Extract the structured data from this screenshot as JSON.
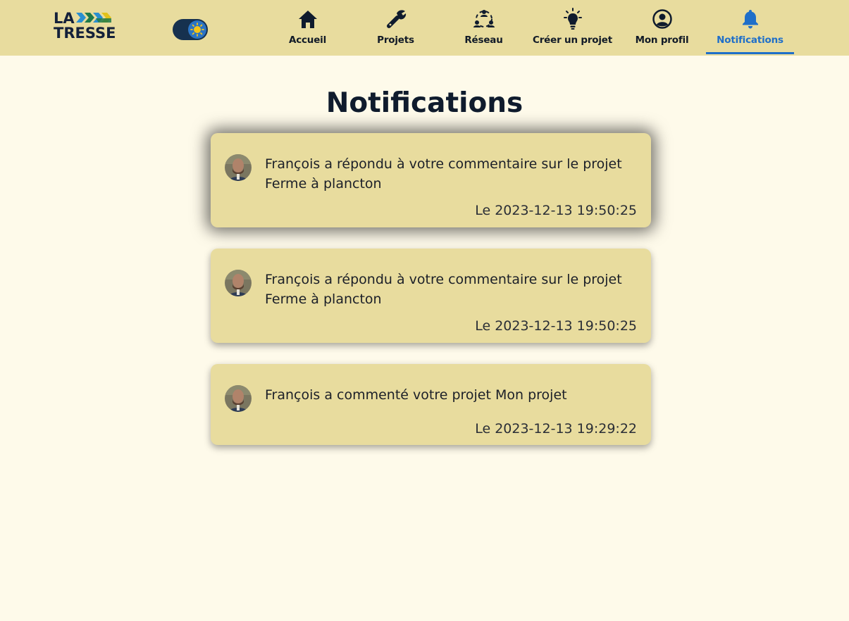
{
  "brand": {
    "line1": "LA",
    "line2": "TRESSE"
  },
  "theme_toggle": {
    "icon": "sun-icon",
    "accent": "#2b74c4"
  },
  "nav": [
    {
      "label": "Accueil",
      "icon": "home-icon"
    },
    {
      "label": "Projets",
      "icon": "tools-icon"
    },
    {
      "label": "Réseau",
      "icon": "network-icon"
    },
    {
      "label": "Créer un projet",
      "icon": "lightbulb-icon"
    },
    {
      "label": "Mon profil",
      "icon": "user-circle-icon"
    },
    {
      "label": "Notifications",
      "icon": "bell-icon",
      "active": true
    }
  ],
  "page": {
    "title": "Notifications"
  },
  "notifications": [
    {
      "text": "François a répondu à votre commentaire sur le projet Ferme à plancton",
      "date": "Le 2023-12-13 19:50:25",
      "avatar": "avatar"
    },
    {
      "text": "François a répondu à votre commentaire sur le projet Ferme à plancton",
      "date": "Le 2023-12-13 19:50:25",
      "avatar": "avatar"
    },
    {
      "text": "François a commenté votre projet Mon projet",
      "date": "Le 2023-12-13 19:29:22",
      "avatar": "avatar"
    }
  ],
  "colors": {
    "header_bg": "#e8dc9e",
    "page_bg": "#fefaea",
    "card_bg": "#e8dc9e",
    "active": "#1f6fc9",
    "text": "#0f1b2d"
  }
}
